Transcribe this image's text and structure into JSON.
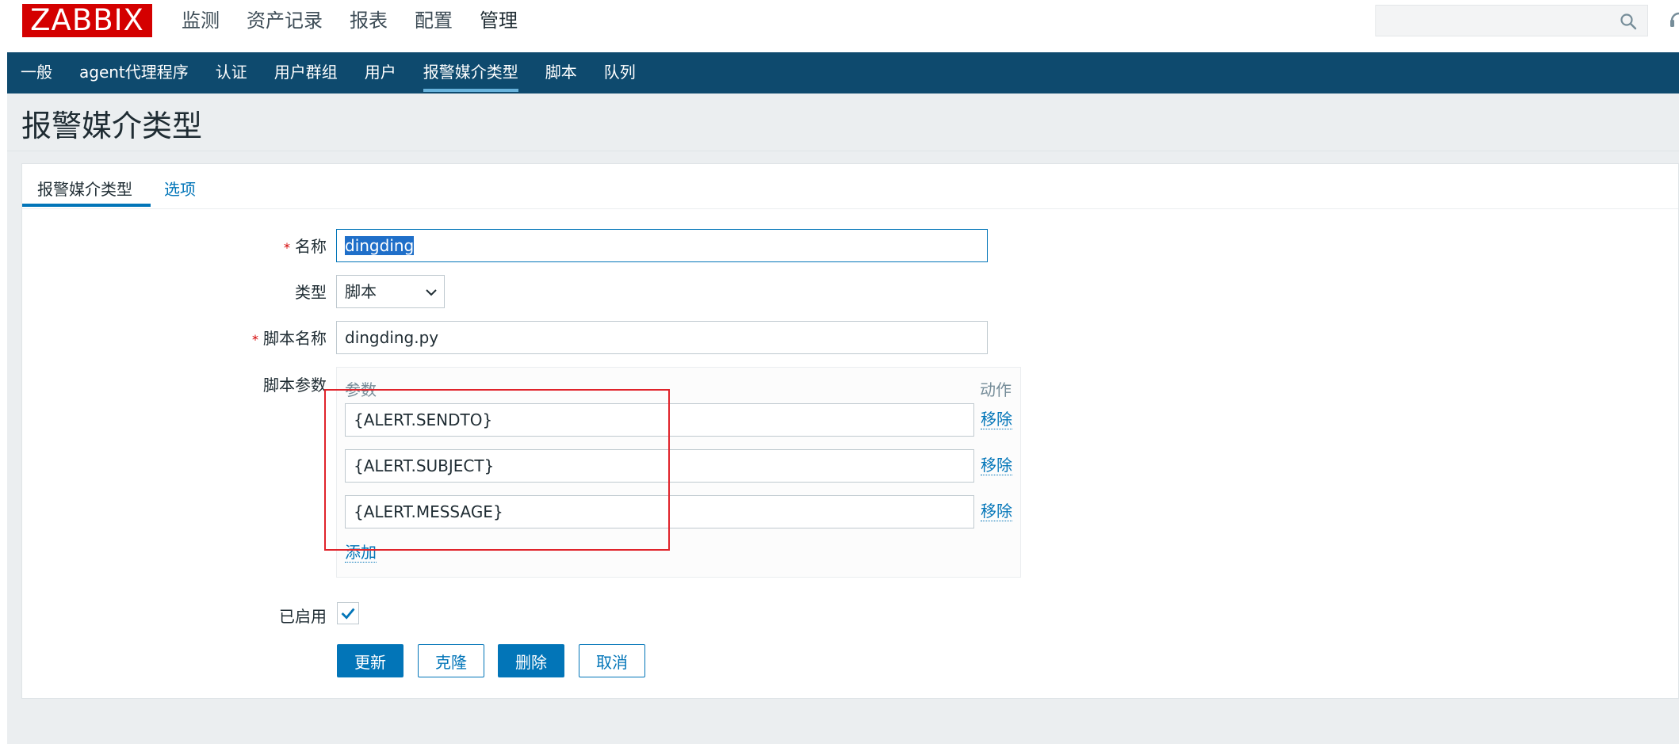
{
  "logo": "ZABBIX",
  "top_nav": [
    {
      "label": "监测"
    },
    {
      "label": "资产记录"
    },
    {
      "label": "报表"
    },
    {
      "label": "配置"
    },
    {
      "label": "管理",
      "active": true
    }
  ],
  "search": {
    "placeholder": ""
  },
  "sub_nav": [
    {
      "label": "一般"
    },
    {
      "label": "agent代理程序"
    },
    {
      "label": "认证"
    },
    {
      "label": "用户群组"
    },
    {
      "label": "用户"
    },
    {
      "label": "报警媒介类型",
      "active": true
    },
    {
      "label": "脚本"
    },
    {
      "label": "队列"
    }
  ],
  "page_title": "报警媒介类型",
  "tabs": [
    {
      "label": "报警媒介类型",
      "active": true
    },
    {
      "label": "选项"
    }
  ],
  "form": {
    "name_label": "名称",
    "name_value": "dingding",
    "type_label": "类型",
    "type_value": "脚本",
    "script_name_label": "脚本名称",
    "script_name_value": "dingding.py",
    "script_params_label": "脚本参数",
    "params_col_header": "参数",
    "action_col_header": "动作",
    "params": [
      {
        "value": "{ALERT.SENDTO}",
        "remove_label": "移除"
      },
      {
        "value": "{ALERT.SUBJECT}",
        "remove_label": "移除"
      },
      {
        "value": "{ALERT.MESSAGE}",
        "remove_label": "移除"
      }
    ],
    "add_label": "添加",
    "enabled_label": "已启用",
    "enabled": true
  },
  "buttons": {
    "update": "更新",
    "clone": "克隆",
    "delete": "删除",
    "cancel": "取消"
  },
  "colors": {
    "brand": "#d40000",
    "nav_bg": "#0e4a6e",
    "accent": "#0275b8",
    "highlight_box": "#e0242b"
  }
}
